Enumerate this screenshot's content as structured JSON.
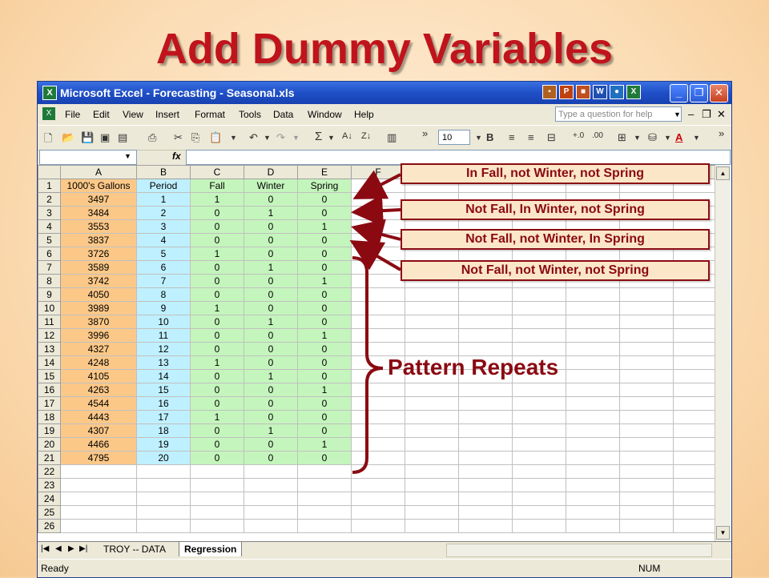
{
  "slide": {
    "title": "Add Dummy Variables"
  },
  "window": {
    "title": "Microsoft Excel - Forecasting - Seasonal.xls"
  },
  "menubar": {
    "items": [
      "File",
      "Edit",
      "View",
      "Insert",
      "Format",
      "Tools",
      "Data",
      "Window",
      "Help"
    ],
    "help_placeholder": "Type a question for help"
  },
  "toolbar": {
    "font_size": "10"
  },
  "sheet": {
    "columns": [
      "A",
      "B",
      "C",
      "D",
      "E",
      "F"
    ],
    "header_row": [
      "1000's Gallons",
      "Period",
      "Fall",
      "Winter",
      "Spring"
    ],
    "rows": [
      [
        "3497",
        "1",
        "1",
        "0",
        "0"
      ],
      [
        "3484",
        "2",
        "0",
        "1",
        "0"
      ],
      [
        "3553",
        "3",
        "0",
        "0",
        "1"
      ],
      [
        "3837",
        "4",
        "0",
        "0",
        "0"
      ],
      [
        "3726",
        "5",
        "1",
        "0",
        "0"
      ],
      [
        "3589",
        "6",
        "0",
        "1",
        "0"
      ],
      [
        "3742",
        "7",
        "0",
        "0",
        "1"
      ],
      [
        "4050",
        "8",
        "0",
        "0",
        "0"
      ],
      [
        "3989",
        "9",
        "1",
        "0",
        "0"
      ],
      [
        "3870",
        "10",
        "0",
        "1",
        "0"
      ],
      [
        "3996",
        "11",
        "0",
        "0",
        "1"
      ],
      [
        "4327",
        "12",
        "0",
        "0",
        "0"
      ],
      [
        "4248",
        "13",
        "1",
        "0",
        "0"
      ],
      [
        "4105",
        "14",
        "0",
        "1",
        "0"
      ],
      [
        "4263",
        "15",
        "0",
        "0",
        "1"
      ],
      [
        "4544",
        "16",
        "0",
        "0",
        "0"
      ],
      [
        "4443",
        "17",
        "1",
        "0",
        "0"
      ],
      [
        "4307",
        "18",
        "0",
        "1",
        "0"
      ],
      [
        "4466",
        "19",
        "0",
        "0",
        "1"
      ],
      [
        "4795",
        "20",
        "0",
        "0",
        "0"
      ]
    ],
    "total_rows": 26
  },
  "tabs": {
    "items": [
      "TROY -- DATA",
      "Regression"
    ],
    "active": "Regression"
  },
  "status": {
    "left": "Ready",
    "num": "NUM"
  },
  "callouts": [
    "In Fall, not Winter, not Spring",
    "Not Fall, In Winter, not Spring",
    "Not Fall, not Winter, In Spring",
    "Not Fall, not Winter, not Spring"
  ],
  "pattern_label": "Pattern Repeats",
  "colors": {
    "title_red": "#c0141c",
    "callout_red": "#8b0a12",
    "col_a": "#fcc888",
    "col_b": "#bff0ff",
    "col_cde": "#c4f5bc"
  }
}
